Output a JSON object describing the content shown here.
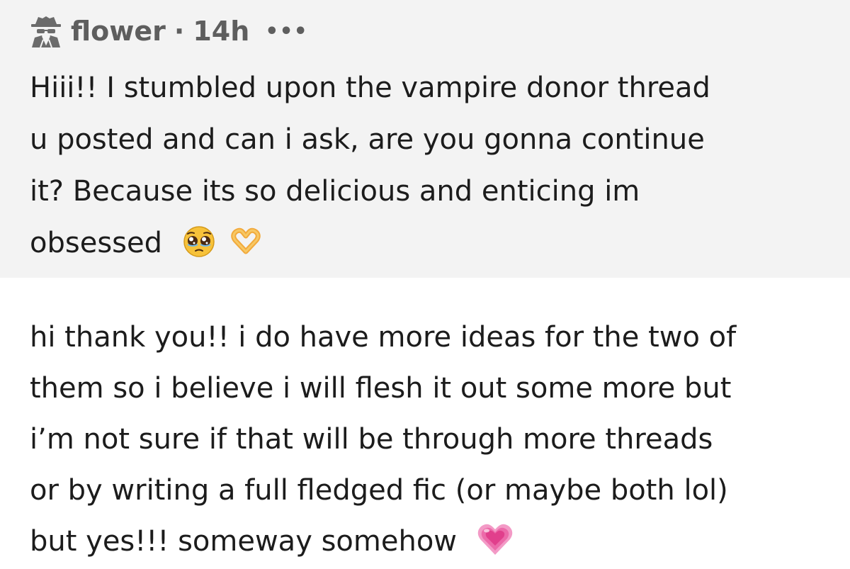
{
  "ask": {
    "asker_name": "flower",
    "separator": "·",
    "time": "14h",
    "more_label": "•••",
    "lines": [
      "Hiii!! I stumbled upon the vampire donor thread",
      "u posted and can i ask, are you gonna continue",
      "it? Because its so delicious and enticing im",
      "obsessed"
    ],
    "emojis": [
      "pleading-face",
      "heart-hands"
    ]
  },
  "answer": {
    "lines": [
      "hi thank you!! i do have more ideas for the two of",
      "them so i believe i will flesh it out some more but",
      "i’m not sure if that will be through more threads",
      "or by writing a full fledged fic (or maybe both lol)",
      "but yes!!! someway somehow"
    ],
    "emojis": [
      "growing-heart"
    ]
  },
  "colors": {
    "ask_background": "#f3f3f3",
    "answer_background": "#ffffff",
    "header_text": "#5e5e5e",
    "body_text": "#1c1c1c"
  }
}
